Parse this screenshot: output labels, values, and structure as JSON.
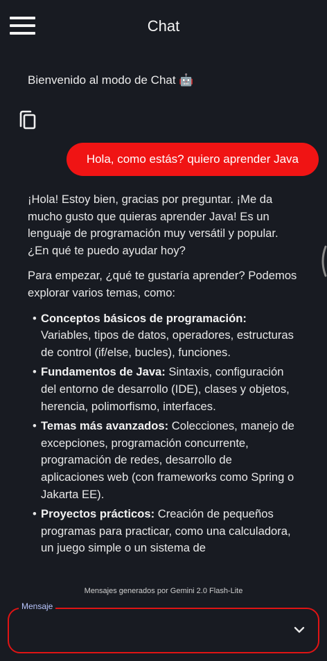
{
  "header": {
    "title": "Chat",
    "menu_icon": "hamburger-menu-icon"
  },
  "welcome": {
    "text": "Bienvenido al modo de Chat 🤖",
    "copy_icon": "copy-icon"
  },
  "user_message": {
    "text": "Hola, como estás? quiero aprender Java",
    "color": "#f01414"
  },
  "bot_message": {
    "para1": "¡Hola! Estoy bien, gracias por preguntar. ¡Me da mucho gusto que quieras aprender Java! Es un lenguaje de programación muy versátil y popular. ¿En qué te puedo ayudar hoy?",
    "para2": "Para empezar, ¿qué te gustaría aprender? Podemos explorar varios temas, como:",
    "items": [
      {
        "title": "Conceptos básicos de programación:",
        "text": " Variables, tipos de datos, operadores, estructuras de control (if/else, bucles), funciones."
      },
      {
        "title": "Fundamentos de Java:",
        "text": " Sintaxis, configuración del entorno de desarrollo (IDE), clases y objetos, herencia, polimorfismo, interfaces."
      },
      {
        "title": "Temas más avanzados:",
        "text": " Colecciones, manejo de excepciones, programación concurrente, programación de redes, desarrollo de aplicaciones web (con frameworks como Spring o Jakarta EE)."
      },
      {
        "title": "Proyectos prácticos:",
        "text": " Creación de pequeños programas para practicar, como una calculadora, un juego simple o un sistema de"
      }
    ]
  },
  "footer": {
    "note": "Mensajes generados por Gemini 2.0 Flash-Lite"
  },
  "input": {
    "label": "Mensaje",
    "value": "",
    "accent": "#e01414",
    "chevron_icon": "chevron-down-icon"
  }
}
